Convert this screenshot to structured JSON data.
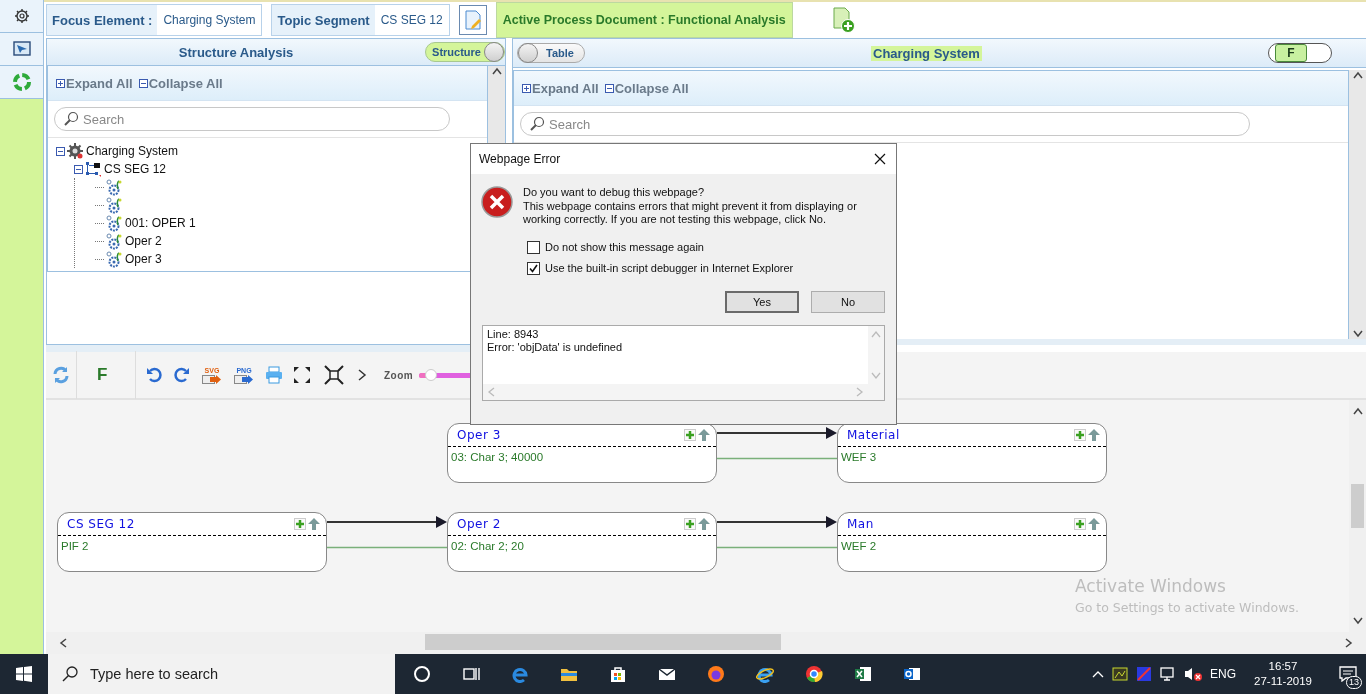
{
  "header": {
    "focus_label": "Focus Element :",
    "focus_value": "Charging System",
    "topic_label": "Topic Segment",
    "topic_value": "CS SEG 12",
    "active_document": "Active Process Document : Functional Analysis"
  },
  "structure_panel": {
    "title": "Structure Analysis",
    "toggle_label": "Structure",
    "expand_all": "Expand All",
    "collapse_all": "Collapse All",
    "search_placeholder": "Search",
    "tree": [
      {
        "label": "Charging System",
        "kind": "system",
        "expanded": true,
        "children": [
          {
            "label": "CS SEG 12",
            "kind": "segment",
            "expanded": true,
            "children": [
              {
                "kind": "operation"
              },
              {
                "kind": "operation"
              },
              {
                "label": "001: OPER 1",
                "kind": "operation"
              },
              {
                "label": "Oper 2",
                "kind": "operation"
              },
              {
                "label": "Oper 3",
                "kind": "operation"
              }
            ]
          }
        ]
      }
    ]
  },
  "table_panel": {
    "toggle_label": "Table",
    "title": "Charging System",
    "filter_toggle": "F",
    "expand_all": "Expand All",
    "collapse_all": "Collapse All",
    "search_placeholder": "Search"
  },
  "toolbar": {
    "filter_label": "F",
    "svg_export": "SVG",
    "png_export": "PNG",
    "zoom_label": "Zoom",
    "zoom": {
      "level": 0.1
    }
  },
  "diagram": {
    "nodes": [
      {
        "title": "Oper 3",
        "detail": "03: Char 3; 40000"
      },
      {
        "title": "Material",
        "detail": "WEF 3"
      },
      {
        "title": "CS SEG 12",
        "detail": "PIF 2"
      },
      {
        "title": "Oper 2",
        "detail": "02: Char 2; 20"
      },
      {
        "title": "Man",
        "detail": "WEF 2"
      }
    ]
  },
  "dialog": {
    "title": "Webpage Error",
    "question": "Do you want to debug this webpage?",
    "message": "This webpage contains errors that might prevent it from displaying or working correctly. If you are not testing this webpage, click No.",
    "options": [
      {
        "label": "Do not show this message again",
        "checked": false
      },
      {
        "label": "Use the built-in script debugger in Internet Explorer",
        "checked": true
      }
    ],
    "buttons": [
      {
        "label": "Yes",
        "selected": true
      },
      {
        "label": "No",
        "selected": false
      }
    ],
    "details": [
      "Line: 8943",
      "Error: 'objData' is undefined"
    ]
  },
  "activation_notice": {
    "title": "Activate Windows",
    "subtitle": "Go to Settings to activate Windows."
  },
  "taskbar": {
    "search_placeholder": "Type here to search",
    "language": "ENG",
    "time": "16:57",
    "date": "27-11-2019",
    "notification_count": "13"
  }
}
